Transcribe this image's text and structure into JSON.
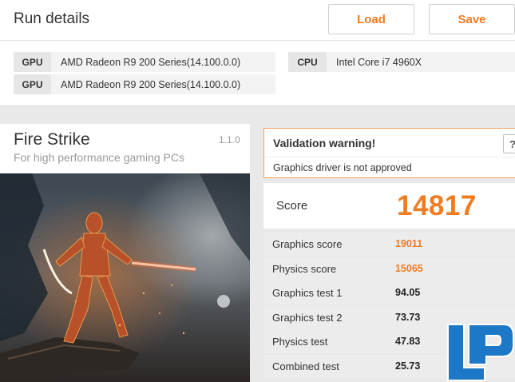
{
  "run_details": {
    "title": "Run details",
    "load_label": "Load",
    "save_label": "Save",
    "specs": [
      {
        "label": "GPU",
        "value": "AMD Radeon R9 200 Series(14.100.0.0)"
      },
      {
        "label": "GPU",
        "value": "AMD Radeon R9 200 Series(14.100.0.0)"
      },
      {
        "label": "CPU",
        "value": "Intel Core i7 4960X"
      }
    ]
  },
  "benchmark": {
    "title": "Fire Strike",
    "subtitle": "For high performance gaming PCs",
    "version": "1.1.0"
  },
  "validation": {
    "title": "Validation warning!",
    "message": "Graphics driver is not approved",
    "help_label": "?"
  },
  "score": {
    "label": "Score",
    "value": "14817"
  },
  "results": [
    {
      "label": "Graphics score",
      "value": "19011",
      "highlight": true
    },
    {
      "label": "Physics score",
      "value": "15065",
      "highlight": true
    },
    {
      "label": "Graphics test 1",
      "value": "94.05",
      "highlight": false
    },
    {
      "label": "Graphics test 2",
      "value": "73.73",
      "highlight": false
    },
    {
      "label": "Physics test",
      "value": "47.83",
      "highlight": false
    },
    {
      "label": "Combined test",
      "value": "25.73",
      "highlight": false
    }
  ],
  "colors": {
    "accent": "#f07c22",
    "row_bg": "#ececec",
    "logo_blue": "#1e78c8"
  },
  "icons": {
    "help": "question-mark-icon",
    "logo": "legit-reviews-logo"
  }
}
